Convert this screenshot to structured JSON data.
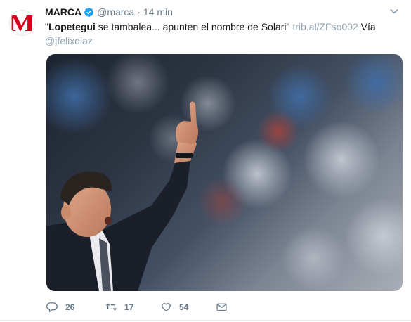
{
  "tweet": {
    "author_name": "MARCA",
    "author_handle": "@marca",
    "separator": "·",
    "time": "14 min",
    "avatar_letter": "M",
    "text_quote_open": "\"",
    "text_bold": "Lopetegui",
    "text_rest": " se tambalea... apunten el nombre de Solari\" ",
    "link": "trib.al/ZFso002",
    "text_via": " Vía",
    "mention": "@jfelixdiaz",
    "image_subject": "coach-pointing-up-photo",
    "reply_count": "26",
    "retweet_count": "17",
    "like_count": "54"
  },
  "colors": {
    "brand_red": "#d6001c",
    "verified_blue": "#1da1f2",
    "muted_text": "#657786",
    "link_text": "#95a5b5"
  },
  "icons": [
    "verified-badge-icon",
    "caret-down-icon",
    "reply-icon",
    "retweet-icon",
    "like-icon",
    "direct-message-icon"
  ]
}
